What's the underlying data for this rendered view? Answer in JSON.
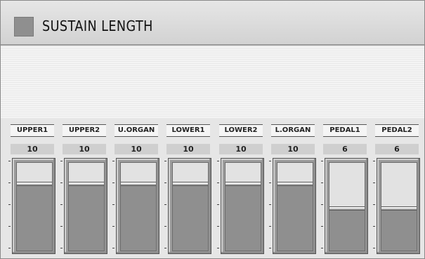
{
  "header": {
    "title": "SUSTAIN LENGTH"
  },
  "fader_max": 10,
  "channels": [
    {
      "label": "UPPER1",
      "value": "10"
    },
    {
      "label": "UPPER2",
      "value": "10"
    },
    {
      "label": "U.ORGAN",
      "value": "10"
    },
    {
      "label": "LOWER1",
      "value": "10"
    },
    {
      "label": "LOWER2",
      "value": "10"
    },
    {
      "label": "L.ORGAN",
      "value": "10"
    },
    {
      "label": "PEDAL1",
      "value": "6"
    },
    {
      "label": "PEDAL2",
      "value": "6"
    }
  ],
  "colors": {
    "fill": "#8f8f8f",
    "track_empty": "#e2e2e2",
    "title_square": "#8f8f8f"
  }
}
